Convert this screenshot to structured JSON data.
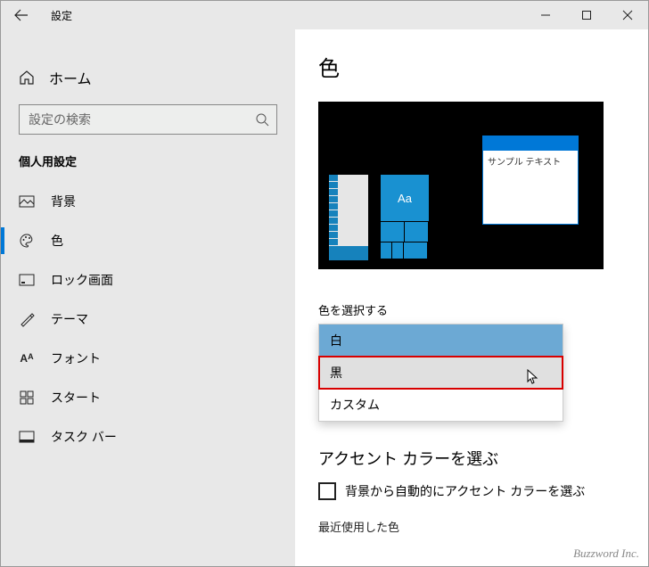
{
  "titlebar": {
    "title": "設定"
  },
  "sidebar": {
    "home_label": "ホーム",
    "search_placeholder": "設定の検索",
    "section_header": "個人用設定",
    "items": [
      {
        "label": "背景"
      },
      {
        "label": "色"
      },
      {
        "label": "ロック画面"
      },
      {
        "label": "テーマ"
      },
      {
        "label": "フォント"
      },
      {
        "label": "スタート"
      },
      {
        "label": "タスク バー"
      }
    ]
  },
  "content": {
    "page_title": "色",
    "preview": {
      "tile_text": "Aa",
      "sample_window_text": "サンプル テキスト"
    },
    "choose_color_label": "色を選択する",
    "dropdown": {
      "options": [
        {
          "label": "白"
        },
        {
          "label": "黒"
        },
        {
          "label": "カスタム"
        }
      ]
    },
    "accent_header": "アクセント カラーを選ぶ",
    "auto_pick_label": "背景から自動的にアクセント カラーを選ぶ",
    "recent_label": "最近使用した色"
  },
  "watermark": "Buzzword Inc."
}
